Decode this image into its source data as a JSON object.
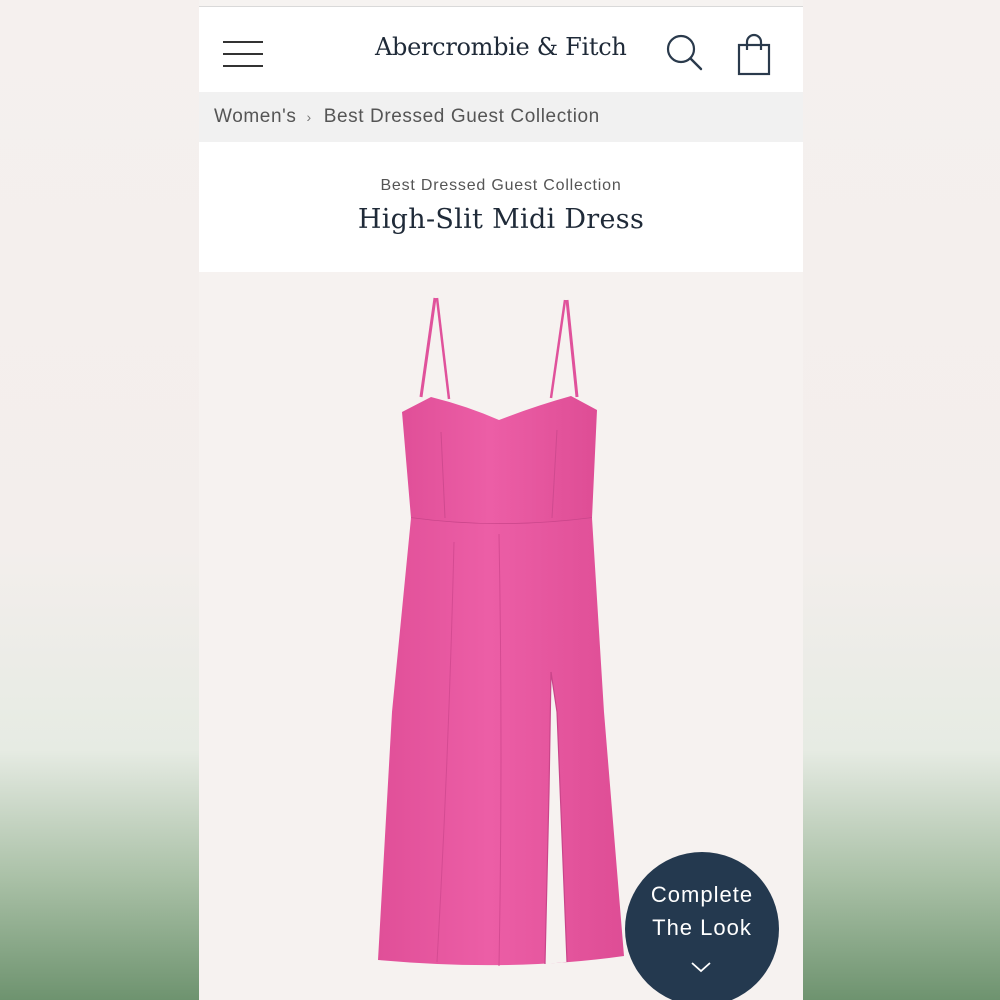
{
  "header": {
    "brand": "Abercrombie & Fitch",
    "menu_icon": "hamburger-menu-icon",
    "search_icon": "search-icon",
    "bag_icon": "shopping-bag-icon"
  },
  "breadcrumb": {
    "items": [
      "Women's",
      "Best Dressed Guest Collection"
    ],
    "separator_icon": "chevron-right-icon"
  },
  "product": {
    "collection": "Best Dressed Guest Collection",
    "title": "High-Slit Midi Dress",
    "color": "#e8579f"
  },
  "complete_look": {
    "line1": "Complete",
    "line2": "The Look",
    "icon": "chevron-down-icon"
  },
  "colors": {
    "navy": "#24394f",
    "brand_text": "#1f2a38",
    "dress_pink": "#e8579f"
  }
}
